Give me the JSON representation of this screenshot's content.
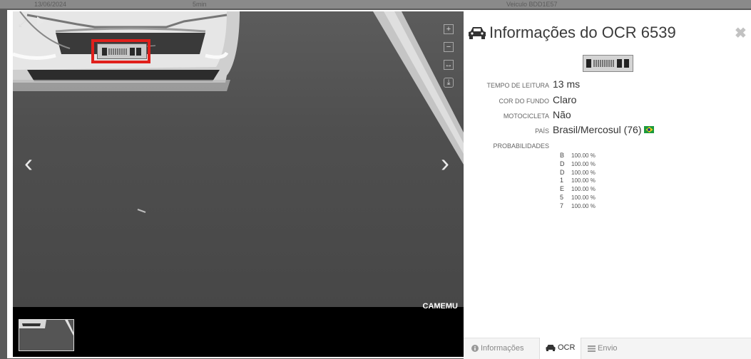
{
  "background_rows": {
    "left_text": "13/06/2024",
    "middle_text": "5min",
    "right_text": "Veiculo BDD1E57"
  },
  "viewer": {
    "camera_label": "CAMEMU",
    "controls": {
      "zoom_in": "+",
      "zoom_out": "−",
      "fit": "↔",
      "download": "⤓"
    },
    "nav": {
      "prev": "‹",
      "next": "›"
    }
  },
  "panel": {
    "title": "Informações do OCR 6539",
    "close": "✖",
    "plate_text": "BDD1E57",
    "fields": [
      {
        "label": "TEMPO DE LEITURA",
        "value": "13 ms"
      },
      {
        "label": "COR DO FUNDO",
        "value": "Claro"
      },
      {
        "label": "MOTOCICLETA",
        "value": "Não"
      },
      {
        "label": "PAÍS",
        "value": "Brasil/Mercosul (76)"
      }
    ],
    "probabilities_label": "PROBABILIDADES",
    "probabilities": [
      {
        "char": "B",
        "value": "100.00 %"
      },
      {
        "char": "D",
        "value": "100.00 %"
      },
      {
        "char": "D",
        "value": "100.00 %"
      },
      {
        "char": "1",
        "value": "100.00 %"
      },
      {
        "char": "E",
        "value": "100.00 %"
      },
      {
        "char": "5",
        "value": "100.00 %"
      },
      {
        "char": "7",
        "value": "100.00 %"
      }
    ],
    "flag_icon": "brazil-flag-icon"
  },
  "tabs": [
    {
      "label": "Informações",
      "icon": "info-icon"
    },
    {
      "label": "OCR",
      "icon": "car-icon",
      "active": true
    },
    {
      "label": "Envio",
      "icon": "list-icon"
    }
  ],
  "colors": {
    "highlight_box": "#e0201c",
    "flag_green": "#1b9a3e",
    "flag_yellow": "#f5d312"
  }
}
